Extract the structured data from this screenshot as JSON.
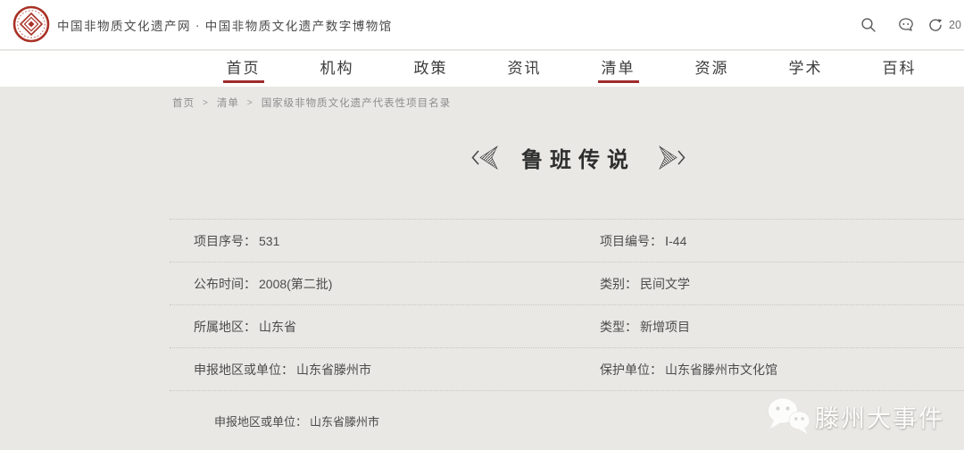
{
  "colors": {
    "accent_red": "#9e2b2b",
    "logo_red": "#a93226",
    "content_background": "#e9e8e5",
    "header_background": "#ffffff",
    "watermark_text_color": "#fcfcfa"
  },
  "header": {
    "site_title": "中国非物质文化遗产网 · 中国非物质文化遗产数字博物馆",
    "clipped_text": "20",
    "icons": [
      "seal-logo-icon",
      "search-icon",
      "comment-icon",
      "share-icon"
    ]
  },
  "nav": {
    "items": [
      {
        "label": "首页",
        "active": true
      },
      {
        "label": "机构",
        "active": false
      },
      {
        "label": "政策",
        "active": false
      },
      {
        "label": "资讯",
        "active": false
      },
      {
        "label": "清单",
        "active": true
      },
      {
        "label": "资源",
        "active": false
      },
      {
        "label": "学术",
        "active": false
      },
      {
        "label": "百科",
        "active": false
      }
    ]
  },
  "breadcrumb": {
    "separator": ">",
    "items": [
      "首页",
      "清单",
      "国家级非物质文化遗产代表性项目名录"
    ]
  },
  "page": {
    "title": "鲁班传说"
  },
  "details": {
    "rows": [
      {
        "left_label": "项目序号：",
        "left_value": "531",
        "right_label": "项目编号：",
        "right_value": "Ⅰ-44"
      },
      {
        "left_label": "公布时间：",
        "left_value": "2008(第二批)",
        "right_label": "类别：",
        "right_value": "民间文学"
      },
      {
        "left_label": "所属地区：",
        "left_value": "山东省",
        "right_label": "类型：",
        "right_value": "新增项目"
      },
      {
        "left_label": "申报地区或单位：",
        "left_value": "山东省滕州市",
        "right_label": "保护单位：",
        "right_value": "山东省滕州市文化馆"
      },
      {
        "left_label": "申报地区或单位：",
        "left_value": "山东省滕州市",
        "right_label": "",
        "right_value": ""
      }
    ]
  },
  "watermark": {
    "icon": "wechat-icon",
    "text": "滕州大事件"
  }
}
